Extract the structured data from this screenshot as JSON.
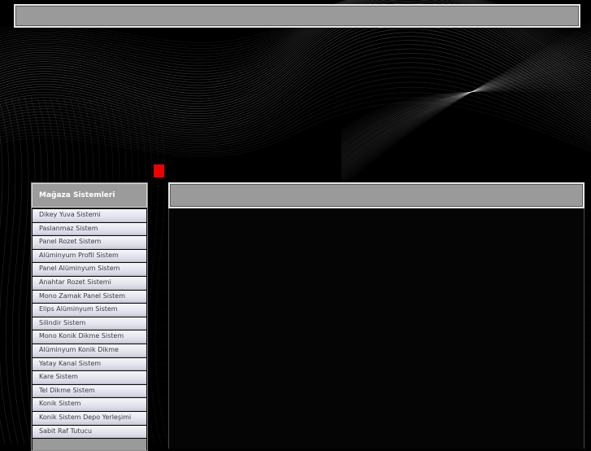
{
  "colors": {
    "page_background": "#000000",
    "bar_gray": "#9a9a9a",
    "marker_red": "#ee0000",
    "menu_text": "#3c3c46"
  },
  "sidebar": {
    "title": "Mağaza Sistemleri",
    "items": [
      "Dikey Yuva Sistemi",
      "Paslanmaz Sistem",
      "Panel Rozet Sistem",
      "Alüminyum Profil Sistem",
      "Panel Alüminyum Sistem",
      "Anahtar Rozet Sistemi",
      "Mono Zamak Panel Sistem",
      "Elips Alüminyum Sistem",
      "Silindir Sistem",
      "Mono Konik Dikme Sistem",
      "Alüminyum Konik Dikme",
      "Yatay Kanal Sistem",
      "Kare Sistem",
      "Tel Dikme Sistem",
      "Konik Sistem",
      "Konik Sistem Depo Yerleşimi",
      "Sabit Raf Tutucu"
    ]
  }
}
